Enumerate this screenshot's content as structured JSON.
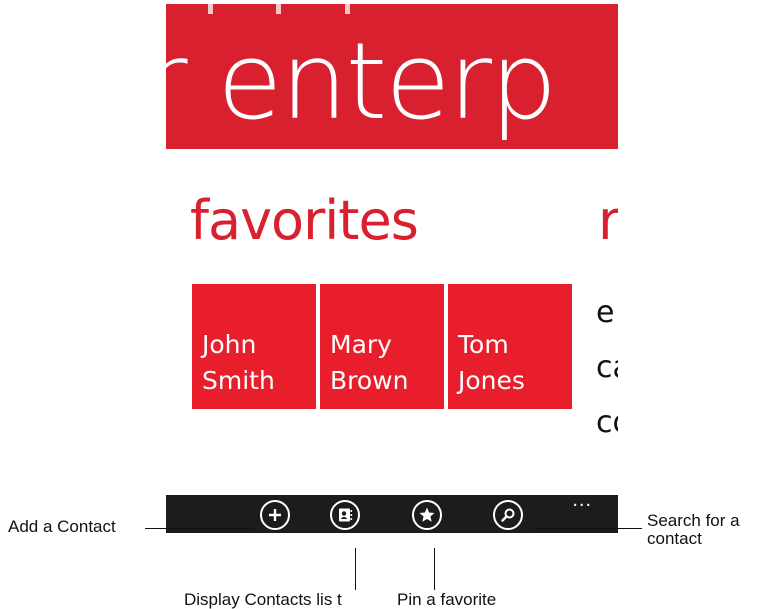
{
  "hero": {
    "title": "r enterp"
  },
  "favorites": {
    "title": "favorites",
    "next_title": "r",
    "contacts": [
      {
        "name": "John\nSmith"
      },
      {
        "name": "Mary\nBrown"
      },
      {
        "name": "Tom\nJones"
      }
    ]
  },
  "side_list": [
    "e",
    "ca",
    "co"
  ],
  "appbar": {
    "buttons": [
      {
        "icon": "plus-icon"
      },
      {
        "icon": "contacts-list-icon"
      },
      {
        "icon": "star-icon"
      },
      {
        "icon": "search-icon"
      }
    ],
    "more": "..."
  },
  "callouts": {
    "add_contact": "Add a Contact",
    "display_list": "Display Contacts lis t",
    "pin_favorite": "Pin a favorite",
    "search_contact": "Search for a\ncontact"
  },
  "colors": {
    "accent": "#d8202e",
    "tile": "#e81e2c",
    "appbar": "#1c1c1c"
  }
}
